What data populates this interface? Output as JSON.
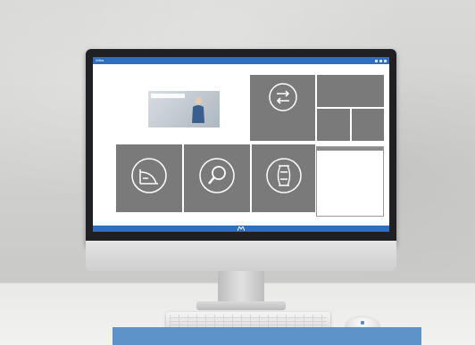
{
  "app": {
    "name": "Wiba"
  },
  "colors": {
    "accent": "#2e6fc2",
    "tile": "#7a7a7a",
    "banner": "#5d93c8"
  },
  "tiles": [
    {
      "icon": "exchange-icon"
    },
    {
      "icon": "measure-icon"
    },
    {
      "icon": "search-icon"
    },
    {
      "icon": "component-icon"
    }
  ]
}
